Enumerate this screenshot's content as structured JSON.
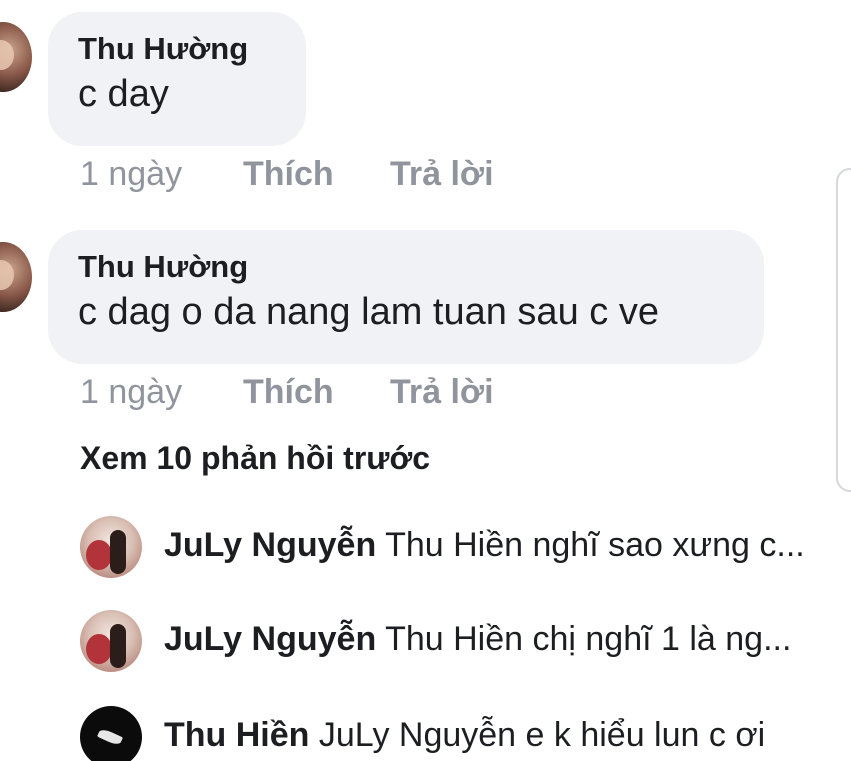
{
  "comments": [
    {
      "author": "Thu Hường",
      "message": "c day",
      "time": "1 ngày",
      "like_label": "Thích",
      "reply_label": "Trả lời"
    },
    {
      "author": "Thu Hường",
      "message": "c dag o da nang lam tuan sau c ve",
      "time": "1 ngày",
      "like_label": "Thích",
      "reply_label": "Trả lời"
    }
  ],
  "view_more_replies": "Xem 10 phản hồi trước",
  "replies": [
    {
      "author": "JuLy Nguyễn",
      "message": "Thu Hiền nghĩ sao xưng c..."
    },
    {
      "author": "JuLy Nguyễn",
      "message": "Thu Hiền chị nghĩ 1 là ng..."
    },
    {
      "author": "Thu Hiền",
      "message": "JuLy Nguyễn e k hiểu lun c ơi"
    }
  ],
  "colors": {
    "bubble_background": "#f0f2f5",
    "primary_text": "#1c1e21",
    "secondary_text": "#90949c"
  }
}
